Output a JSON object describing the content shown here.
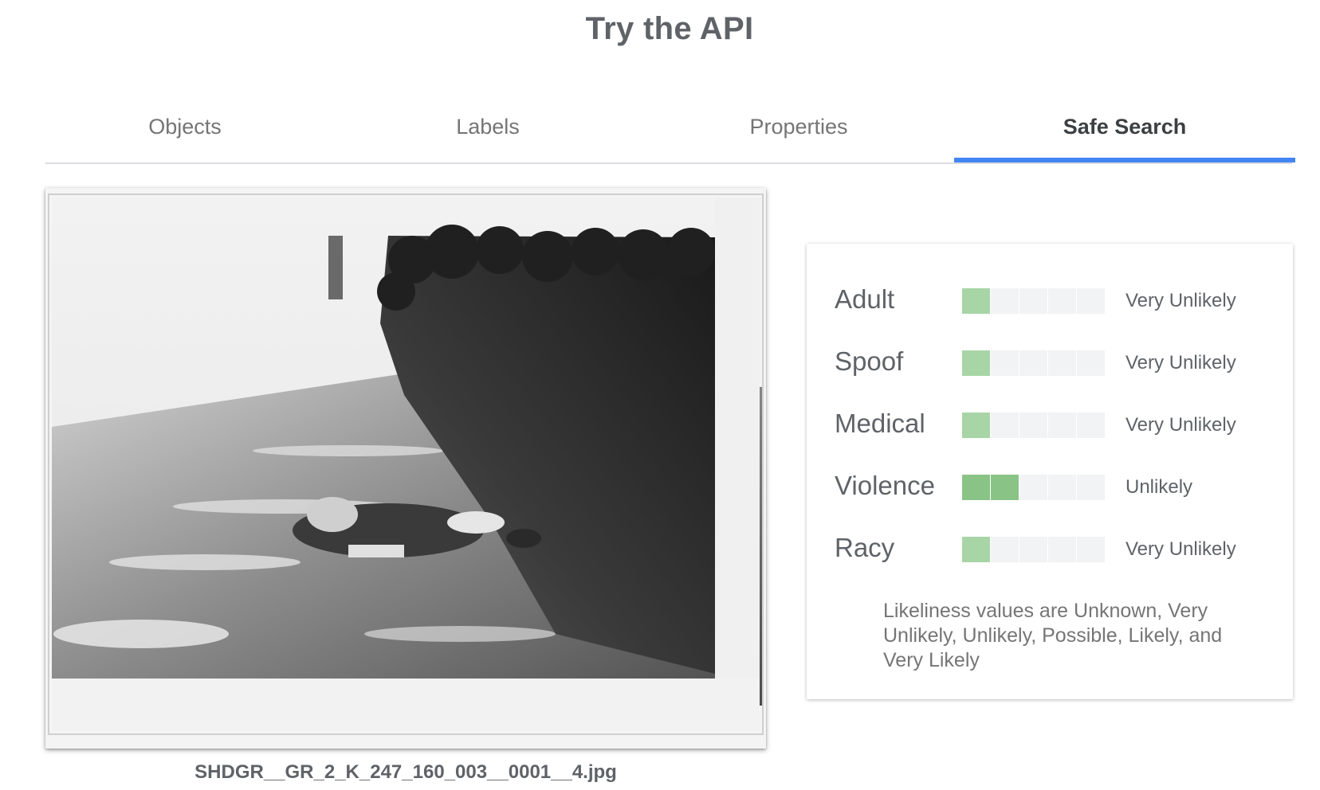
{
  "header": {
    "title": "Try the API"
  },
  "tabs": [
    {
      "label": "Objects",
      "active": false
    },
    {
      "label": "Labels",
      "active": false
    },
    {
      "label": "Properties",
      "active": false
    },
    {
      "label": "Safe Search",
      "active": true
    }
  ],
  "image": {
    "filename": "SHDGR__GR_2_K_247_160_003__0001__4.jpg"
  },
  "safe_search": {
    "scale_levels": 5,
    "colors": {
      "level_filled": "#a8d5a6",
      "level_filled_strong": "#89c486",
      "level_empty": "#f1f3f4",
      "accent": "#4285f4"
    },
    "rows": [
      {
        "label": "Adult",
        "value": "Very Unlikely",
        "level": 1
      },
      {
        "label": "Spoof",
        "value": "Very Unlikely",
        "level": 1
      },
      {
        "label": "Medical",
        "value": "Very Unlikely",
        "level": 1
      },
      {
        "label": "Violence",
        "value": "Unlikely",
        "level": 2
      },
      {
        "label": "Racy",
        "value": "Very Unlikely",
        "level": 1
      }
    ],
    "note": "Likeliness values are Unknown, Very Unlikely, Unlikely, Possible, Likely, and Very Likely"
  }
}
